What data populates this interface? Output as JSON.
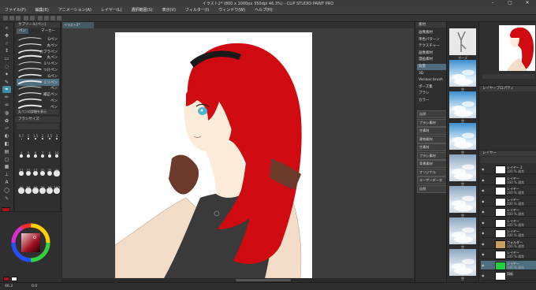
{
  "window": {
    "title": "イラスト2* (800 x 1000px 350dpi 46.3%) - CLIP STUDIO PAINT PRO"
  },
  "menu": {
    "items": [
      "ファイル(F)",
      "編集(E)",
      "アニメーション(A)",
      "レイヤー(L)",
      "選択範囲(S)",
      "表示(V)",
      "フィルター(I)",
      "ウィンドウ(W)",
      "ヘルプ(H)"
    ]
  },
  "subtool": {
    "header": "サブツール[ペン]",
    "tabs": [
      "ペン",
      "マーカー"
    ],
    "brushes": [
      {
        "label": "Gペン",
        "selected": false
      },
      {
        "label": "丸ペン",
        "selected": false
      },
      {
        "label": "カブラペン",
        "selected": false
      },
      {
        "label": "丸ペン",
        "selected": false
      },
      {
        "label": "ミリペン",
        "selected": false
      },
      {
        "label": "つけペン",
        "selected": false
      },
      {
        "label": "Gペン",
        "selected": false
      },
      {
        "label": "ミリペン",
        "selected": true
      },
      {
        "label": "ペン",
        "selected": false
      },
      {
        "label": "補正ペン",
        "selected": false
      },
      {
        "label": "ペン",
        "selected": false
      },
      {
        "label": "ペン",
        "selected": false
      }
    ],
    "footer": "丸ペンの詳細を表示"
  },
  "brush_size": {
    "header": "ブラシサイズ",
    "labels": [
      "0.7",
      "1",
      "1.5",
      "2",
      "2.5",
      "3",
      "4",
      "5",
      "6",
      "7",
      "8",
      "10",
      "12",
      "15",
      "17",
      "20",
      "25",
      "30",
      "40",
      "50",
      "60",
      "70",
      "80",
      "100"
    ]
  },
  "colors": {
    "main": "#b0111b",
    "sub": "#ffffff",
    "accent": "#3d8ea6",
    "selected_row": "#4d6f80",
    "hair": "#cf0a10",
    "skin": "#fcebd9",
    "coat": "#f3dcc8",
    "scarf": "#6b3a2b",
    "shirt": "#3a3a3a",
    "eye": "#4ab6d6"
  },
  "status": {
    "zoom": "46.3",
    "angle": "0.0"
  },
  "material_panel": {
    "header": "素材",
    "rows": [
      {
        "label": "画像素材",
        "selected": false
      },
      {
        "label": "単色パターン",
        "selected": false
      },
      {
        "label": "テクスチャー",
        "selected": false
      },
      {
        "label": "画像素材",
        "selected": false
      },
      {
        "label": "漫画素材",
        "selected": false
      },
      {
        "label": "背景",
        "selected": true
      },
      {
        "label": "3D",
        "selected": false
      },
      {
        "label": "Various brush",
        "selected": false
      },
      {
        "label": "ポーズ集",
        "selected": false
      },
      {
        "label": "ブラシ",
        "selected": false
      },
      {
        "label": "カラー",
        "selected": false
      }
    ],
    "buttons": [
      "自然",
      "ブラシ素材",
      "空素材",
      "建物素材",
      "空素材",
      "ブラシ素材",
      "背景素材",
      "オリジナル",
      "ユーザーデータ",
      "自然"
    ]
  },
  "material_grid": {
    "captions": [
      "ポーズ",
      "空",
      "空",
      "空",
      "空",
      "空",
      "空",
      "空"
    ]
  },
  "layers": {
    "header": "レイヤー",
    "items": [
      {
        "name": "レイヤー 2",
        "sub": "100 % 通常",
        "selected": false
      },
      {
        "name": "レイヤー",
        "sub": "100 % 通常",
        "selected": false
      },
      {
        "name": "レイヤー",
        "sub": "100 % 通常",
        "selected": false
      },
      {
        "name": "レイヤー",
        "sub": "100 % 通常",
        "selected": false
      },
      {
        "name": "レイヤー",
        "sub": "100 % 通常",
        "selected": false
      },
      {
        "name": "レイヤー",
        "sub": "100 % 通常",
        "selected": false
      },
      {
        "name": "レイヤー",
        "sub": "100 % 通常",
        "selected": false
      },
      {
        "name": "フォルダー",
        "sub": "100 % 通常",
        "selected": false
      },
      {
        "name": "レイヤー",
        "sub": "100 % 通常",
        "selected": false
      },
      {
        "name": "レイヤー",
        "sub": "100 % 通常",
        "selected": true
      },
      {
        "name": "用紙",
        "sub": "",
        "selected": false
      }
    ]
  },
  "layer_property": {
    "header": "レイヤープロパティ"
  }
}
